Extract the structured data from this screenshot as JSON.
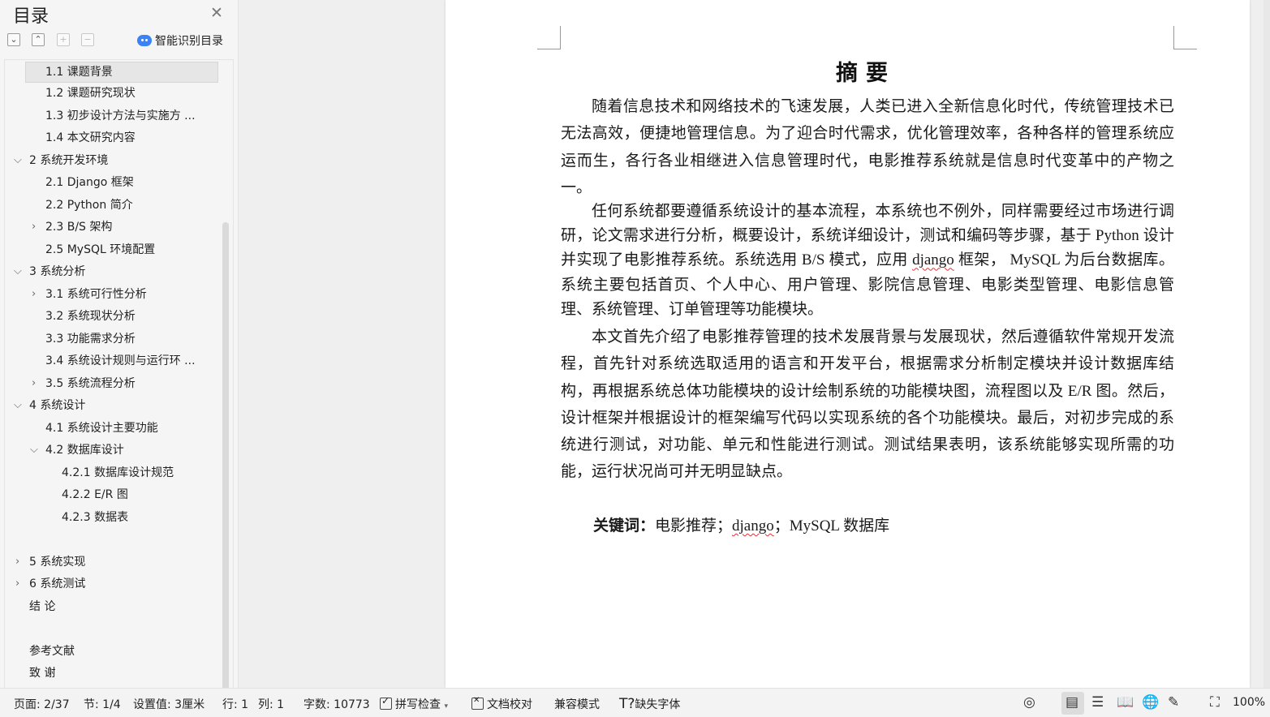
{
  "sidebar": {
    "title": "目录",
    "smart_toc_label": "智能识别目录",
    "items": [
      {
        "label": "1.1  课题背景",
        "selected": true
      },
      {
        "label": "1.2  课题研究现状"
      },
      {
        "label": "1.3  初步设计方法与实施方 ..."
      },
      {
        "label": "1.4  本文研究内容"
      },
      {
        "label": "2  系统开发环境",
        "state": "expanded"
      },
      {
        "label": "2.1 Django 框架"
      },
      {
        "label": "2.2 Python 简介"
      },
      {
        "label": "2.3 B/S 架构",
        "state": "collapsed"
      },
      {
        "label": "2.5 MySQL 环境配置"
      },
      {
        "label": "3  系统分析",
        "state": "expanded"
      },
      {
        "label": "3.1  系统可行性分析",
        "state": "collapsed"
      },
      {
        "label": "3.2  系统现状分析"
      },
      {
        "label": "3.3  功能需求分析"
      },
      {
        "label": "3.4  系统设计规则与运行环 ..."
      },
      {
        "label": "3.5 系统流程分析",
        "state": "collapsed"
      },
      {
        "label": "4  系统设计",
        "state": "expanded"
      },
      {
        "label": "4.1  系统设计主要功能"
      },
      {
        "label": "4.2  数据库设计",
        "state": "expanded"
      },
      {
        "label": "4.2.1  数据库设计规范"
      },
      {
        "label": "4.2.2 E/R 图"
      },
      {
        "label": "4.2.3  数据表"
      },
      {
        "label": "5  系统实现",
        "state": "collapsed"
      },
      {
        "label": "6  系统测试",
        "state": "collapsed"
      },
      {
        "label": "结  论"
      },
      {
        "label": "参考文献"
      },
      {
        "label": "致  谢"
      }
    ]
  },
  "document": {
    "title": "摘要",
    "para1": "随着信息技术和网络技术的飞速发展，人类已进入全新信息化时代，传统管理技术已无法高效，便捷地管理信息。为了迎合时代需求，优化管理效率，各种各样的管理系统应运而生，各行各业相继进入信息管理时代，电影推荐系统就是信息时代变革中的产物之一。",
    "para2_a": "任何系统都要遵循系统设计的基本流程，本系统也不例外，同样需要经过市场进行调研，论文需求进行分析，概要设计，系统详细设计，测试和编码等步骤，基于 Python 设计并实现了电影推荐系统。系统选用 B/S 模式，应用 ",
    "para2_django": "django",
    "para2_b": " 框架，  MySQL 为后台数据库。系统主要包括首页、个人中心、用户管理、影院信息管理、电影类型管理、电影信息管理、系统管理、订单管理等功能模块。",
    "para3": "本文首先介绍了电影推荐管理的技术发展背景与发展现状，然后遵循软件常规开发流程，首先针对系统选取适用的语言和开发平台，根据需求分析制定模块并设计数据库结构，再根据系统总体功能模块的设计绘制系统的功能模块图，流程图以及 E/R 图。然后，设计框架并根据设计的框架编写代码以实现系统的各个功能模块。最后，对初步完成的系统进行测试，对功能、单元和性能进行测试。测试结果表明，该系统能够实现所需的功能，运行状况尚可并无明显缺点。",
    "keywords_label": "关键词：",
    "keywords_a": "电影推荐；",
    "keywords_django": "django",
    "keywords_b": "；MySQL 数据库"
  },
  "statusbar": {
    "page": "页面: 2/37",
    "section": "节: 1/4",
    "setting": "设置值: 3厘米",
    "row": "行: 1",
    "col": "列: 1",
    "wordcount": "字数: 10773",
    "spellcheck": "拼写检查",
    "proofread": "文档校对",
    "compat": "兼容模式",
    "missing_font": "缺失字体",
    "zoom": "100%"
  }
}
